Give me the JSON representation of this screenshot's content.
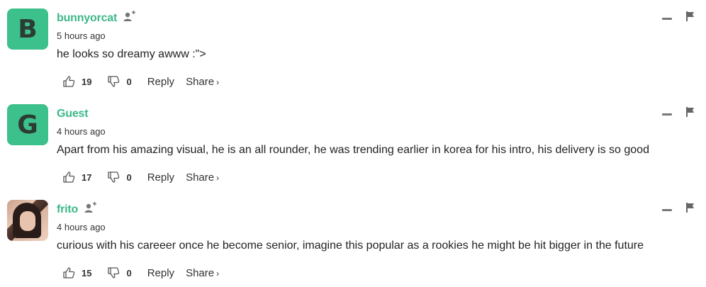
{
  "colors": {
    "accent": "#3cb888",
    "avatar_bg": "#3cc08c",
    "text": "#222222"
  },
  "icons": {
    "like": "thumbs-up-icon",
    "dislike": "thumbs-down-icon",
    "follow": "add-user-icon",
    "minimize": "minus-icon",
    "flag": "flag-icon",
    "share_chevron": "chevron-right-icon"
  },
  "labels": {
    "reply": "Reply",
    "share": "Share",
    "chevron": "›"
  },
  "comments": [
    {
      "avatar_letter": "B",
      "username": "bunnyorcat",
      "has_follow": true,
      "time": "5 hours ago",
      "text": "he looks so dreamy awww :\">",
      "likes": "19",
      "dislikes": "0"
    },
    {
      "avatar_letter": "G",
      "username": "Guest",
      "has_follow": false,
      "time": "4 hours ago",
      "text": "Apart from his amazing visual, he is an all rounder, he was trending earlier in korea for his intro, his delivery is so good",
      "likes": "17",
      "dislikes": "0"
    },
    {
      "avatar_letter": "",
      "username": "frito",
      "has_follow": true,
      "time": "4 hours ago",
      "text": "curious with his careeer once he become senior, imagine this popular as a rookies he might be hit bigger in the future",
      "likes": "15",
      "dislikes": "0"
    }
  ]
}
